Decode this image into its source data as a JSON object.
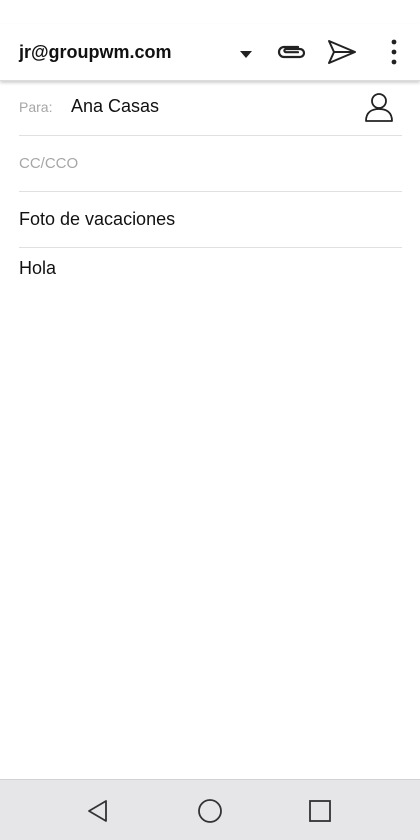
{
  "toolbar": {
    "account": "jr@groupwm.com",
    "icons": {
      "dropdown": "dropdown-triangle-icon",
      "attach": "paperclip-icon",
      "send": "send-icon",
      "more": "more-vertical-icon"
    }
  },
  "compose": {
    "to_label": "Para:",
    "to_value": "Ana Casas",
    "contact_icon": "person-icon",
    "cc_placeholder": "CC/CCO",
    "subject": "Foto de vacaciones",
    "body": "Hola"
  },
  "nav": {
    "back": "back-triangle-icon",
    "home": "home-circle-icon",
    "recent": "recent-square-icon"
  }
}
